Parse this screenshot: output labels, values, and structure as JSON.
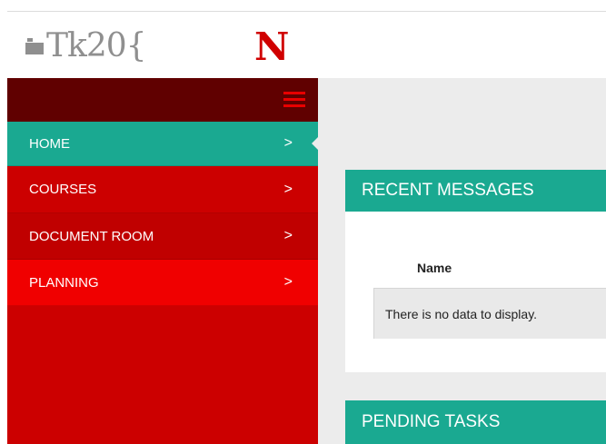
{
  "header": {
    "logo_text": "Tk20{",
    "university_logo": "N"
  },
  "sidebar": {
    "menu_icon": "hamburger-menu-icon",
    "items": [
      {
        "label": "HOME",
        "active": true
      },
      {
        "label": "COURSES"
      },
      {
        "label": "DOCUMENT ROOM"
      },
      {
        "label": "PLANNING"
      }
    ],
    "chevron": ">"
  },
  "main": {
    "recent_messages": {
      "title": "RECENT MESSAGES",
      "column_name": "Name",
      "empty_text": "There is no data to display."
    },
    "pending_tasks": {
      "title": "PENDING TASKS"
    }
  },
  "colors": {
    "teal": "#1aa991",
    "red": "#cc0000",
    "dark_red": "#600000",
    "bright_red": "#f00000"
  }
}
